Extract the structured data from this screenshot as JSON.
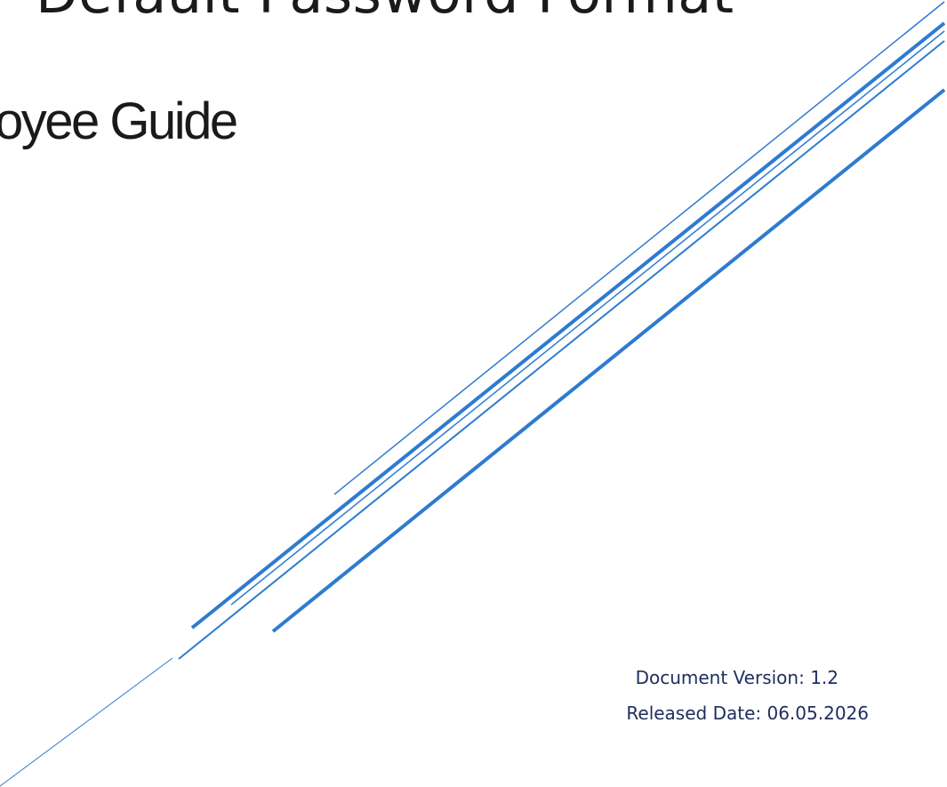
{
  "document": {
    "title": "Default Password Format",
    "subtitle": "oyee Guide",
    "version": "Document Version: 1.2",
    "released": "Released Date: 06.05.2026"
  },
  "colors": {
    "line_blue": "#2e7bd0",
    "text_dark": "#1a1a1a",
    "meta_navy": "#1f2d5c"
  }
}
